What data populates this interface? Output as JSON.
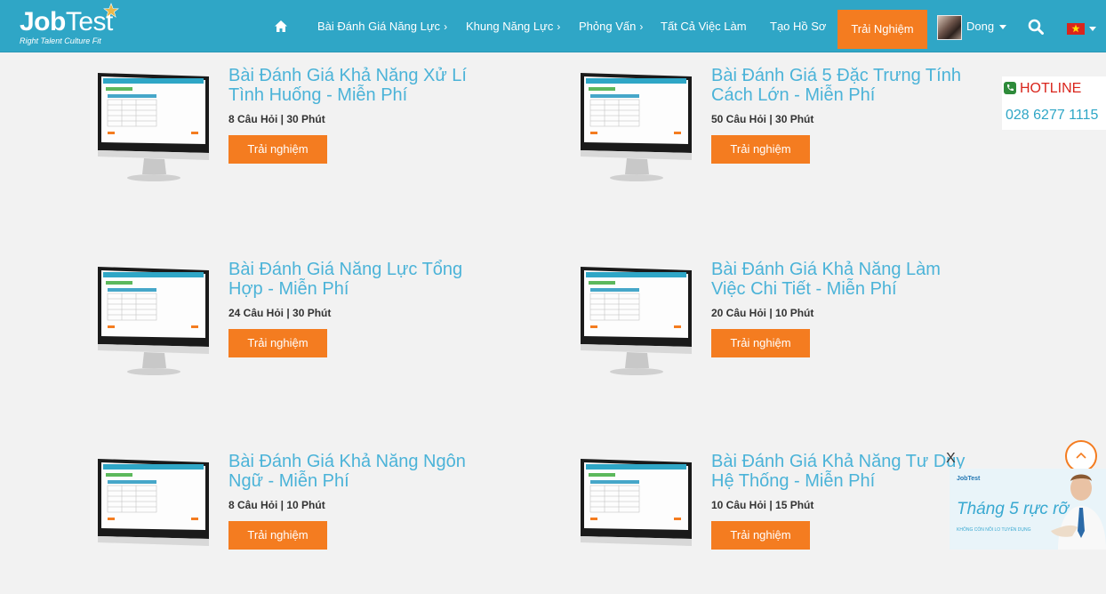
{
  "header": {
    "logo_main_bold": "Job",
    "logo_main_rest": "Test",
    "logo_sub": "Right Talent Culture Fit",
    "nav": [
      {
        "label": "Bài Đánh Giá Năng Lực",
        "chevron": "›"
      },
      {
        "label": "Khung Năng Lực",
        "chevron": "›"
      },
      {
        "label": "Phỏng Vấn",
        "chevron": "›"
      },
      {
        "label": "Tất Cả Việc Làm",
        "chevron": ""
      },
      {
        "label": "Tạo Hồ Sơ",
        "chevron": ""
      }
    ],
    "cta": "Trải Nghiệm",
    "user_name": "Dong",
    "icons": {
      "home": "home-icon",
      "search": "search-icon",
      "flag": "vietnam-flag-icon"
    }
  },
  "tests": [
    {
      "title": "Bài Đánh Giá Khả Năng Xử Lí Tình Huống - Miễn Phí",
      "meta": "8 Câu Hỏi | 30 Phút",
      "button": "Trải nghiệm"
    },
    {
      "title": "Bài Đánh Giá 5 Đặc Trưng Tính Cách Lớn - Miễn Phí",
      "meta": "50 Câu Hỏi | 30 Phút",
      "button": "Trải nghiệm"
    },
    {
      "title": "Bài Đánh Giá Năng Lực Tổng Hợp - Miễn Phí",
      "meta": "24 Câu Hỏi | 30 Phút",
      "button": "Trải nghiệm"
    },
    {
      "title": "Bài Đánh Giá Khả Năng Làm Việc Chi Tiết - Miễn Phí",
      "meta": "20 Câu Hỏi | 10 Phút",
      "button": "Trải nghiệm"
    },
    {
      "title": "Bài Đánh Giá Khả Năng Ngôn Ngữ - Miễn Phí",
      "meta": "8 Câu Hỏi | 10 Phút",
      "button": "Trải nghiệm"
    },
    {
      "title": "Bài Đánh Giá Khả Năng Tư Duy Hệ Thống - Miễn Phí",
      "meta": "10 Câu Hỏi | 15 Phút",
      "button": "Trải nghiệm"
    }
  ],
  "hotline": {
    "label": "HOTLINE",
    "number": "028 6277 1115"
  },
  "ad": {
    "logo": "JobTest",
    "headline": "Tháng 5 rực rỡ",
    "sub": "KHÔNG CÒN NỖI LO TUYỂN DỤNG",
    "close": "X"
  },
  "colors": {
    "nav_bg": "#2fa6c6",
    "accent": "#f47c20",
    "title": "#4bb3d8",
    "hotline_red": "#d9251c"
  }
}
